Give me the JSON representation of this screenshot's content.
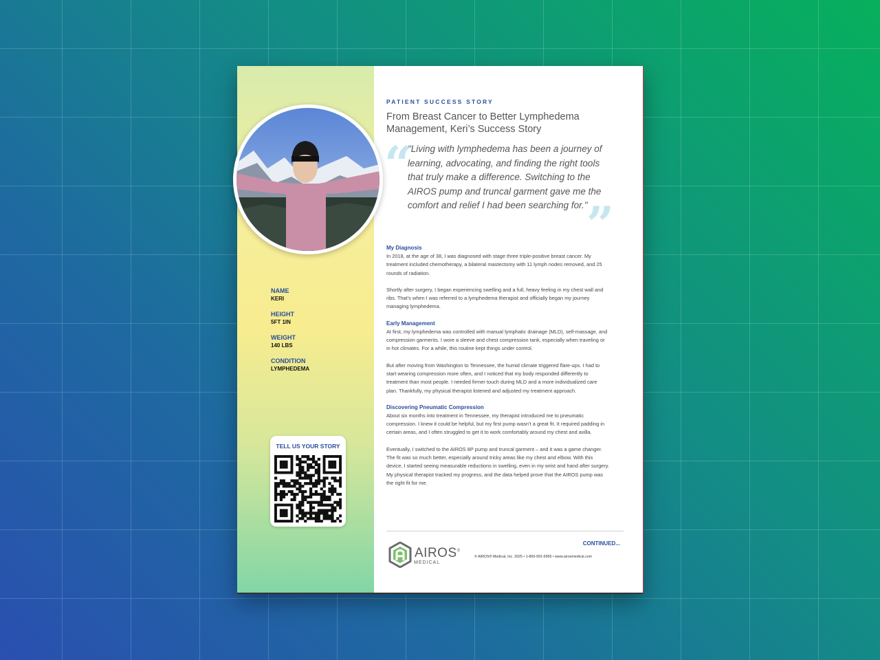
{
  "document": {
    "kicker": "PATIENT SUCCESS STORY",
    "title": "From Breast Cancer to Better Lymphedema Management, Keri’s Success Story",
    "quote": "\"Living with lymphedema has been a journey of learning, advocating, and finding the right tools that truly make a difference. Switching to the AIROS pump and truncal garment gave me the comfort and relief I had been searching for.\"",
    "quote_open_mark": "“",
    "quote_close_mark": "”",
    "profile": {
      "name_label": "NAME",
      "name_value": "KERI",
      "height_label": "HEIGHT",
      "height_value": "5FT 1IN",
      "weight_label": "WEIGHT",
      "weight_value": "140 LBS",
      "condition_label": "CONDITION",
      "condition_value": "LYMPHEDEMA"
    },
    "qr_title": "TELL US YOUR STORY",
    "sections": {
      "s1_heading": "My Diagnosis",
      "s1_p1": "In 2018, at the age of 38, I was diagnosed with stage three triple-positive breast cancer. My treatment included chemotherapy, a bilateral mastectomy with 11 lymph nodes removed, and 25 rounds of radiation.",
      "s1_p2": "Shortly after surgery, I began experiencing swelling and a full, heavy feeling in my chest wall and ribs. That’s when I was referred to a lymphedema therapist and officially began my journey managing lymphedema.",
      "s2_heading": "Early Management",
      "s2_p1": "At first, my lymphedema was controlled with manual lymphatic drainage (MLD), self-massage, and compression garments. I wore a sleeve and chest compression tank, especially when traveling or in hot climates. For a while, this routine kept things under control.",
      "s2_p2": "But after moving from Washington to Tennessee, the humid climate triggered flare-ups. I had to start wearing compression more often, and I noticed that my body responded differently to treatment than most people. I needed firmer touch during MLD and a more individualized care plan. Thankfully, my physical therapist listened and adjusted my treatment approach.",
      "s3_heading": "Discovering Pneumatic Compression",
      "s3_p1": "About six months into treatment in Tennessee, my therapist introduced me to pneumatic compression. I knew it could be helpful, but my first pump wasn’t a great fit. It required padding in certain areas, and I often struggled to get it to work comfortably around my chest and axilla.",
      "s3_p2": "Eventually, I switched to the AIROS 8P pump and truncal garment – and it was a game changer. The fit was so much better, especially around tricky areas like my chest and elbow. With this device, I started seeing measurable reductions in swelling, even in my wrist and hand after surgery. My physical therapist tracked my progress, and the data helped prove that the AIROS pump was the right fit for me."
    },
    "footer": {
      "logo_name": "AIROS",
      "logo_reg": "®",
      "logo_sub": "MEDICAL",
      "continued": "CONTINUED...",
      "copyright": "© AIROS® Medical, Inc. 2025 • 1-866-991-6956 • www.airosmedical.com"
    }
  }
}
